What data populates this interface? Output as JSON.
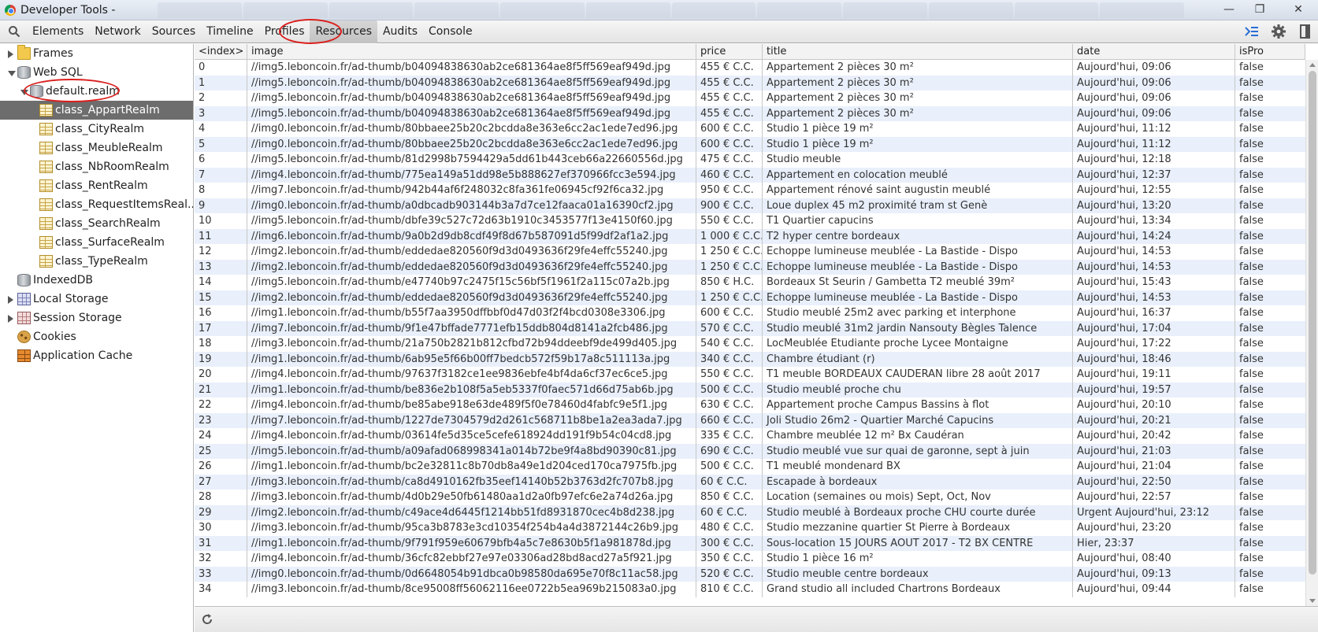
{
  "window": {
    "title": "Developer Tools -",
    "minimize": "—",
    "maximize": "❐",
    "close": "✕"
  },
  "toolbar": {
    "tabs": [
      "Elements",
      "Network",
      "Sources",
      "Timeline",
      "Profiles",
      "Resources",
      "Audits",
      "Console"
    ],
    "active_tab": "Resources"
  },
  "sidebar": {
    "items": [
      {
        "label": "Frames",
        "level": 0,
        "arrow": "right",
        "icon": "folder-icon"
      },
      {
        "label": "Web SQL",
        "level": 0,
        "arrow": "down",
        "icon": "database-icon"
      },
      {
        "label": "default.realm",
        "level": 1,
        "arrow": "down",
        "icon": "database-icon"
      },
      {
        "label": "class_AppartRealm",
        "level": 2,
        "arrow": "",
        "icon": "table-icon",
        "selected": true
      },
      {
        "label": "class_CityRealm",
        "level": 2,
        "arrow": "",
        "icon": "table-icon"
      },
      {
        "label": "class_MeubleRealm",
        "level": 2,
        "arrow": "",
        "icon": "table-icon"
      },
      {
        "label": "class_NbRoomRealm",
        "level": 2,
        "arrow": "",
        "icon": "table-icon"
      },
      {
        "label": "class_RentRealm",
        "level": 2,
        "arrow": "",
        "icon": "table-icon"
      },
      {
        "label": "class_RequestItemsReal...",
        "level": 2,
        "arrow": "",
        "icon": "table-icon"
      },
      {
        "label": "class_SearchRealm",
        "level": 2,
        "arrow": "",
        "icon": "table-icon"
      },
      {
        "label": "class_SurfaceRealm",
        "level": 2,
        "arrow": "",
        "icon": "table-icon"
      },
      {
        "label": "class_TypeRealm",
        "level": 2,
        "arrow": "",
        "icon": "table-icon"
      },
      {
        "label": "IndexedDB",
        "level": 0,
        "arrow": "",
        "icon": "database-icon"
      },
      {
        "label": "Local Storage",
        "level": 0,
        "arrow": "right",
        "icon": "grid-icon"
      },
      {
        "label": "Session Storage",
        "level": 0,
        "arrow": "right",
        "icon": "grid-red-icon"
      },
      {
        "label": "Cookies",
        "level": 0,
        "arrow": "",
        "icon": "cookie-icon"
      },
      {
        "label": "Application Cache",
        "level": 0,
        "arrow": "",
        "icon": "cache-icon"
      }
    ]
  },
  "table": {
    "columns": [
      "<index>",
      "image",
      "price",
      "title",
      "date",
      "isPro"
    ],
    "rows": [
      [
        "0",
        "//img5.leboncoin.fr/ad-thumb/b04094838630ab2ce681364ae8f5ff569eaf949d.jpg",
        "455 € C.C.",
        "Appartement 2 pièces 30 m²",
        "Aujourd'hui, 09:06",
        "false"
      ],
      [
        "1",
        "//img5.leboncoin.fr/ad-thumb/b04094838630ab2ce681364ae8f5ff569eaf949d.jpg",
        "455 € C.C.",
        "Appartement 2 pièces 30 m²",
        "Aujourd'hui, 09:06",
        "false"
      ],
      [
        "2",
        "//img5.leboncoin.fr/ad-thumb/b04094838630ab2ce681364ae8f5ff569eaf949d.jpg",
        "455 € C.C.",
        "Appartement 2 pièces 30 m²",
        "Aujourd'hui, 09:06",
        "false"
      ],
      [
        "3",
        "//img5.leboncoin.fr/ad-thumb/b04094838630ab2ce681364ae8f5ff569eaf949d.jpg",
        "455 € C.C.",
        "Appartement 2 pièces 30 m²",
        "Aujourd'hui, 09:06",
        "false"
      ],
      [
        "4",
        "//img0.leboncoin.fr/ad-thumb/80bbaee25b20c2bcdda8e363e6cc2ac1ede7ed96.jpg",
        "600 € C.C.",
        "Studio 1 pièce 19 m²",
        "Aujourd'hui, 11:12",
        "false"
      ],
      [
        "5",
        "//img0.leboncoin.fr/ad-thumb/80bbaee25b20c2bcdda8e363e6cc2ac1ede7ed96.jpg",
        "600 € C.C.",
        "Studio 1 pièce 19 m²",
        "Aujourd'hui, 11:12",
        "false"
      ],
      [
        "6",
        "//img5.leboncoin.fr/ad-thumb/81d2998b7594429a5dd61b443ceb66a22660556d.jpg",
        "475 € C.C.",
        "Studio meuble",
        "Aujourd'hui, 12:18",
        "false"
      ],
      [
        "7",
        "//img4.leboncoin.fr/ad-thumb/775ea149a51dd98e5b888627ef370966fcc3e594.jpg",
        "460 € C.C.",
        "Appartement en colocation meublé",
        "Aujourd'hui, 12:37",
        "false"
      ],
      [
        "8",
        "//img7.leboncoin.fr/ad-thumb/942b44af6f248032c8fa361fe06945cf92f6ca32.jpg",
        "950 € C.C.",
        "Appartement rénové saint augustin meublé",
        "Aujourd'hui, 12:55",
        "false"
      ],
      [
        "9",
        "//img0.leboncoin.fr/ad-thumb/a0dbcadb903144b3a7d7ce12faaca01a16390cf2.jpg",
        "900 € C.C.",
        "Loue duplex 45 m2 proximité tram st Genè",
        "Aujourd'hui, 13:20",
        "false"
      ],
      [
        "10",
        "//img5.leboncoin.fr/ad-thumb/dbfe39c527c72d63b1910c3453577f13e4150f60.jpg",
        "550 € C.C.",
        "T1 Quartier capucins",
        "Aujourd'hui, 13:34",
        "false"
      ],
      [
        "11",
        "//img6.leboncoin.fr/ad-thumb/9a0b2d9db8cdf49f8d67b587091d5f99df2af1a2.jpg",
        "1 000 € C.C.",
        "T2 hyper centre bordeaux",
        "Aujourd'hui, 14:24",
        "false"
      ],
      [
        "12",
        "//img2.leboncoin.fr/ad-thumb/eddedae820560f9d3d0493636f29fe4effc55240.jpg",
        "1 250 € C.C.",
        "Echoppe lumineuse meublée - La Bastide - Dispo",
        "Aujourd'hui, 14:53",
        "false"
      ],
      [
        "13",
        "//img2.leboncoin.fr/ad-thumb/eddedae820560f9d3d0493636f29fe4effc55240.jpg",
        "1 250 € C.C.",
        "Echoppe lumineuse meublée - La Bastide - Dispo",
        "Aujourd'hui, 14:53",
        "false"
      ],
      [
        "14",
        "//img5.leboncoin.fr/ad-thumb/e47740b97c2475f15c56bf5f1961f2a115c07a2b.jpg",
        "850 € H.C.",
        "Bordeaux St Seurin / Gambetta T2 meublé 39m²",
        "Aujourd'hui, 15:43",
        "false"
      ],
      [
        "15",
        "//img2.leboncoin.fr/ad-thumb/eddedae820560f9d3d0493636f29fe4effc55240.jpg",
        "1 250 € C.C.",
        "Echoppe lumineuse meublée - La Bastide - Dispo",
        "Aujourd'hui, 14:53",
        "false"
      ],
      [
        "16",
        "//img1.leboncoin.fr/ad-thumb/b55f7aa3950dffbbf0d47d03f2f4bcd0308e3306.jpg",
        "600 € C.C.",
        "Studio meublé 25m2 avec parking et interphone",
        "Aujourd'hui, 16:37",
        "false"
      ],
      [
        "17",
        "//img7.leboncoin.fr/ad-thumb/9f1e47bffade7771efb15ddb804d8141a2fcb486.jpg",
        "570 € C.C.",
        "Studio meublé 31m2 jardin Nansouty Bègles Talence",
        "Aujourd'hui, 17:04",
        "false"
      ],
      [
        "18",
        "//img3.leboncoin.fr/ad-thumb/21a750b2821b812cfbd72b94ddeebf9de499d405.jpg",
        "540 € C.C.",
        "LocMeublée Etudiante proche Lycee Montaigne",
        "Aujourd'hui, 17:22",
        "false"
      ],
      [
        "19",
        "//img1.leboncoin.fr/ad-thumb/6ab95e5f66b00ff7bedcb572f59b17a8c511113a.jpg",
        "340 € C.C.",
        "Chambre étudiant (r)",
        "Aujourd'hui, 18:46",
        "false"
      ],
      [
        "20",
        "//img4.leboncoin.fr/ad-thumb/97637f3182ce1ee9836ebfe4bf4da6cf37ec6ce5.jpg",
        "550 € C.C.",
        "T1 meuble BORDEAUX CAUDERAN libre 28 août 2017",
        "Aujourd'hui, 19:11",
        "false"
      ],
      [
        "21",
        "//img1.leboncoin.fr/ad-thumb/be836e2b108f5a5eb5337f0faec571d66d75ab6b.jpg",
        "500 € C.C.",
        "Studio meublé proche chu",
        "Aujourd'hui, 19:57",
        "false"
      ],
      [
        "22",
        "//img4.leboncoin.fr/ad-thumb/be85abe918e63de489f5f0e78460d4fabfc9e5f1.jpg",
        "630 € C.C.",
        "Appartement proche Campus Bassins à flot",
        "Aujourd'hui, 20:10",
        "false"
      ],
      [
        "23",
        "//img7.leboncoin.fr/ad-thumb/1227de7304579d2d261c568711b8be1a2ea3ada7.jpg",
        "660 € C.C.",
        "Joli Studio 26m2 - Quartier Marché Capucins",
        "Aujourd'hui, 20:21",
        "false"
      ],
      [
        "24",
        "//img4.leboncoin.fr/ad-thumb/03614fe5d35ce5cefe618924dd191f9b54c04cd8.jpg",
        "335 € C.C.",
        "Chambre meublée 12 m² Bx Caudéran",
        "Aujourd'hui, 20:42",
        "false"
      ],
      [
        "25",
        "//img5.leboncoin.fr/ad-thumb/a09afad068998341a014b72be9f4a8bd90390c81.jpg",
        "690 € C.C.",
        "Studio meublé vue sur quai de garonne, sept à juin",
        "Aujourd'hui, 21:03",
        "false"
      ],
      [
        "26",
        "//img1.leboncoin.fr/ad-thumb/bc2e32811c8b70db8a49e1d204ced170ca7975fb.jpg",
        "500 € C.C.",
        "T1 meublé mondenard BX",
        "Aujourd'hui, 21:04",
        "false"
      ],
      [
        "27",
        "//img3.leboncoin.fr/ad-thumb/ca8d4910162fb35eef14140b52b3763d2fc707b8.jpg",
        "60 € C.C.",
        "Escapade à bordeaux",
        "Aujourd'hui, 22:50",
        "false"
      ],
      [
        "28",
        "//img3.leboncoin.fr/ad-thumb/4d0b29e50fb61480aa1d2a0fb97efc6e2a74d26a.jpg",
        "850 € C.C.",
        "Location (semaines ou mois) Sept, Oct, Nov",
        "Aujourd'hui, 22:57",
        "false"
      ],
      [
        "29",
        "//img2.leboncoin.fr/ad-thumb/c49ace4d6445f1214bb51fd8931870cec4b8d238.jpg",
        "60 € C.C.",
        "Studio meublé à Bordeaux proche CHU courte durée",
        "Urgent Aujourd'hui, 23:12",
        "false"
      ],
      [
        "30",
        "//img3.leboncoin.fr/ad-thumb/95ca3b8783e3cd10354f254b4a4d3872144c26b9.jpg",
        "480 € C.C.",
        "Studio mezzanine quartier St Pierre à Bordeaux",
        "Aujourd'hui, 23:20",
        "false"
      ],
      [
        "31",
        "//img1.leboncoin.fr/ad-thumb/9f791f959e60679bfb4a5c7e8630b5f1a981878d.jpg",
        "300 € C.C.",
        "Sous-location 15 JOURS AOUT 2017 - T2 BX CENTRE",
        "Hier, 23:37",
        "false"
      ],
      [
        "32",
        "//img4.leboncoin.fr/ad-thumb/36cfc82ebbf27e97e03306ad28bd8acd27a5f921.jpg",
        "350 € C.C.",
        "Studio 1 pièce 16 m²",
        "Aujourd'hui, 08:40",
        "false"
      ],
      [
        "33",
        "//img0.leboncoin.fr/ad-thumb/0d6648054b91dbca0b98580da695e70f8c11ac58.jpg",
        "520 € C.C.",
        "Studio meuble centre bordeaux",
        "Aujourd'hui, 09:13",
        "false"
      ],
      [
        "34",
        "//img3.leboncoin.fr/ad-thumb/8ce95008ff56062116ee0722b5ea969b215083a0.jpg",
        "810 € C.C.",
        "Grand studio all included Chartrons Bordeaux",
        "Aujourd'hui, 09:44",
        "false"
      ]
    ]
  },
  "icons": {
    "search": "search-icon",
    "console_drawer": "console-drawer-icon",
    "settings": "gear-icon",
    "dock": "dock-side-icon",
    "refresh": "refresh-icon"
  },
  "colors": {
    "annotation_red": "#d9201e",
    "selected_row": "#6d6d6d",
    "alt_row": "#e9f0fb"
  }
}
